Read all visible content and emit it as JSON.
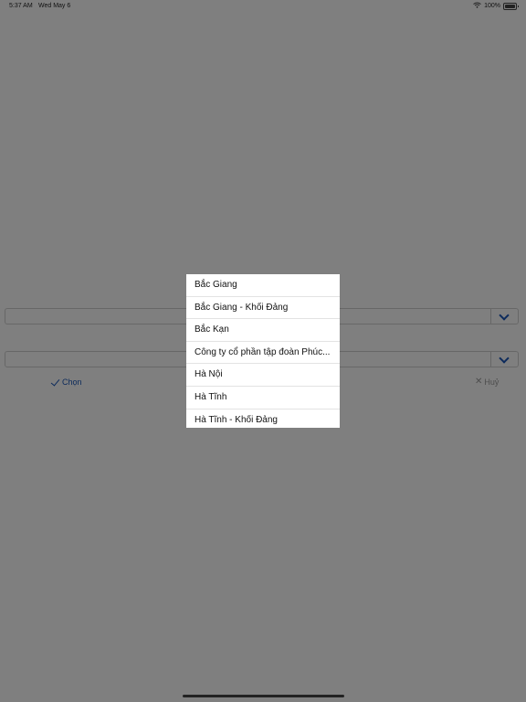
{
  "status_bar": {
    "time": "5:37 AM",
    "date": "Wed May 6",
    "battery": "100%"
  },
  "form": {
    "choose_label": "Chọn",
    "cancel_label": "Huỷ"
  },
  "picker": {
    "items": [
      "Bắc Giang",
      "Bắc Giang - Khối Đảng",
      "Bắc Kạn",
      "Công ty cổ phần tập đoàn Phúc...",
      "Hà Nội",
      "Hà Tĩnh",
      "Hà Tĩnh - Khối Đảng"
    ]
  },
  "colors": {
    "accent": "#1a56b8",
    "overlay": "#7f7f7f"
  }
}
